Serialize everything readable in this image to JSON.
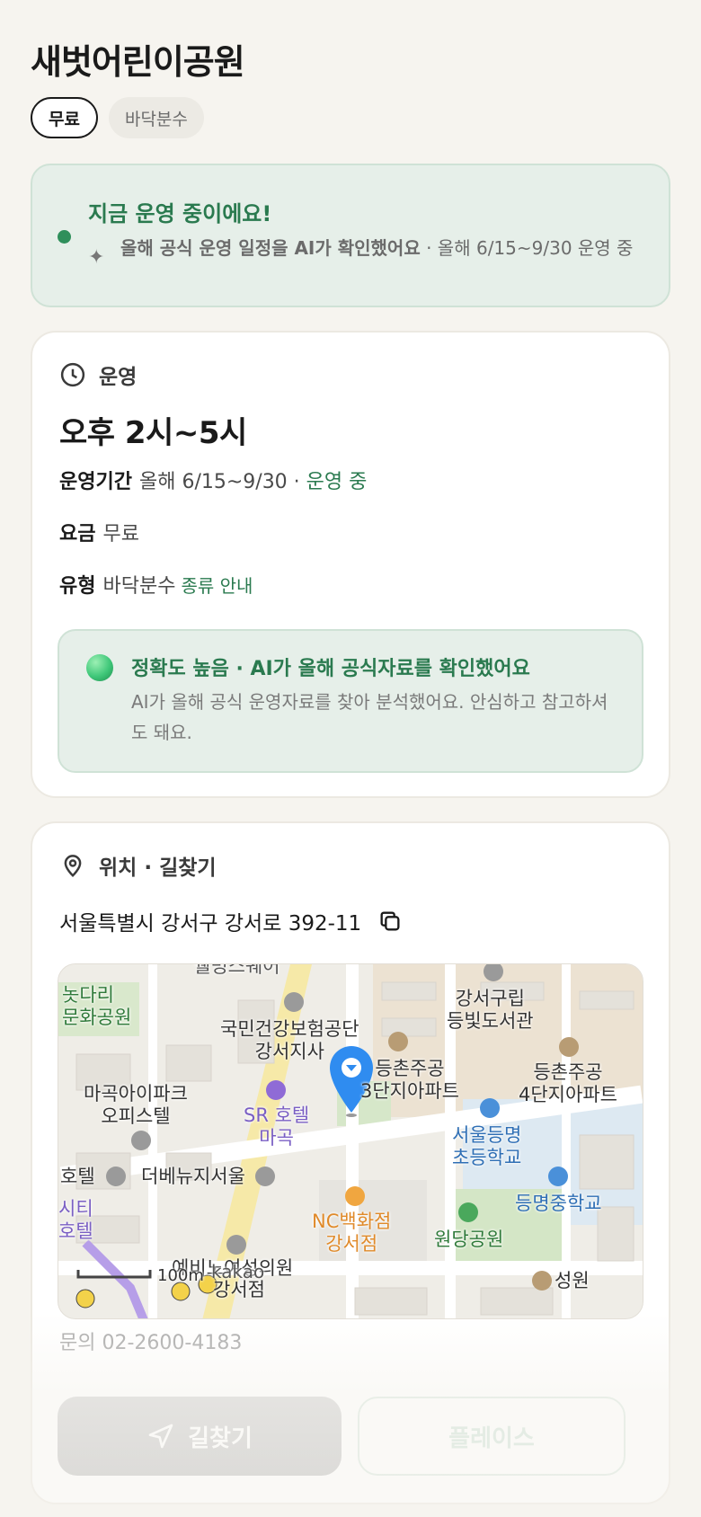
{
  "page": {
    "title": "새벗어린이공원",
    "chips": [
      "무료",
      "바닥분수"
    ]
  },
  "status": {
    "headline": "지금 운영 중이에요!",
    "sub_bold": "올해 공식 운영 일정을 AI가 확인했어요",
    "sub_rest": " · 올해 6/15~9/30 운영 중"
  },
  "operation": {
    "section_label": "운영",
    "hours": "오후 2시~5시",
    "period_key": "운영기간",
    "period_value": "올해 6/15~9/30 · ",
    "period_status": "운영 중",
    "fee_key": "요금",
    "fee_value": "무료",
    "type_key": "유형",
    "type_value": "바닥분수",
    "type_link": "종류 안내",
    "accuracy_head": "정확도 높음 · AI가 올해 공식자료를 확인했어요",
    "accuracy_body": "AI가 올해 공식 운영자료를 찾아 분석했어요. 안심하고 참고하셔도 돼요."
  },
  "location": {
    "section_label": "위치 · 길찾기",
    "address": "서울특별시 강서구 강서로 392-11",
    "map_labels": {
      "park1": "놋다리\n문화공원",
      "nhis": "국민건강보험공단\n강서지사",
      "library": "강서구립\n등빛도서관",
      "apt3": "등촌주공\n3단지아파트",
      "apt4": "등촌주공\n4단지아파트",
      "magok": "마곡아이파크\n오피스텔",
      "sr": "SR 호텔\n마곡",
      "school1": "서울등명\n초등학교",
      "school2": "등명중학교",
      "hotel": "호텔",
      "theview": "더베뉴지서울",
      "city": "시티\n호텔",
      "nc": "NC백화점\n강서점",
      "park2": "원당공원",
      "clinic": "예비노여성의원",
      "gangseo": "강서점",
      "seongwon": "성원",
      "scale": "100m",
      "brand": "kakao",
      "top_cut": "웰빙스퀘어"
    },
    "inquiry": "문의 02-2600-4183",
    "btn_route": "길찾기",
    "btn_place": "플레이스"
  },
  "colors": {
    "accent_green": "#2a7a4f",
    "card_bg": "#ffffff",
    "page_bg": "#f6f4ef",
    "pin_blue": "#2f8cf0"
  }
}
